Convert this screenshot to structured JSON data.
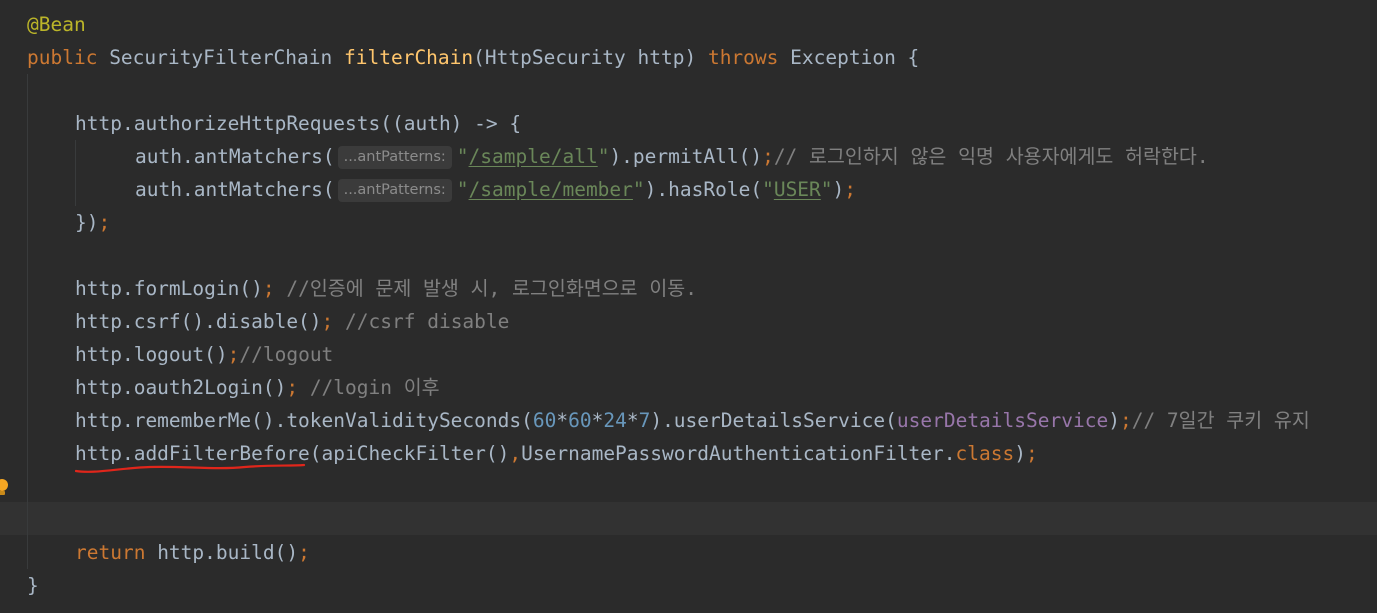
{
  "code": {
    "annotation": "@Bean",
    "sig": {
      "mod": "public",
      "ret_type": " SecurityFilterChain ",
      "method": "filterChain",
      "params": "(HttpSecurity http) ",
      "throws_kw": "throws",
      "rest": " Exception {"
    },
    "authorize_line": "http.authorizeHttpRequests((auth) -> {",
    "matcher1": {
      "pre": "auth.antMatchers(",
      "hint": "...antPatterns:",
      "q1": "\"",
      "path": "/sample/all",
      "q2": "\"",
      "mid": ").permitAll()",
      "semi": ";",
      "comment": "// 로그인하지 않은 익명 사용자에게도 허락한다."
    },
    "matcher2": {
      "pre": "auth.antMatchers(",
      "hint": "...antPatterns:",
      "q1": "\"",
      "path": "/sample/member",
      "q2": "\"",
      "mid": ").hasRole(",
      "q3": "\"",
      "role": "USER",
      "q4": "\"",
      "close": ")",
      "semi": ";"
    },
    "close_lambda": "})",
    "close_semi": ";",
    "formlogin": {
      "code": "http.formLogin()",
      "semi": ";",
      "comment": " //인증에 문제 발생 시, 로그인화면으로 이동."
    },
    "csrf": {
      "code": "http.csrf().disable()",
      "semi": ";",
      "comment": " //csrf disable"
    },
    "logout": {
      "code": "http.logout()",
      "semi": ";",
      "comment": "//logout"
    },
    "oauth": {
      "code": "http.oauth2Login()",
      "semi": ";",
      "comment": " //login 이후"
    },
    "remember": {
      "pre": "http.rememberMe().tokenValiditySeconds(",
      "n1": "60",
      "op1": "*",
      "n2": "60",
      "op2": "*",
      "n3": "24",
      "op3": "*",
      "n4": "7",
      "mid": ").userDetailsService(",
      "field": "userDetailsService",
      "close": ")",
      "semi": ";",
      "comment": "// 7일간 쿠키 유지"
    },
    "addfilter": {
      "pre": "http.addFilterBefore(apiCheckFilter()",
      "comma": ",",
      "cls": "UsernamePasswordAuthenticationFilter.",
      "class_kw": "class",
      "close": ")",
      "semi": ";"
    },
    "ret": {
      "kw": "return",
      "code": " http.build()",
      "semi": ";"
    },
    "close_brace": "}"
  },
  "colors": {
    "background": "#2b2b2b",
    "current_line": "#323232",
    "keyword": "#cc7832",
    "annotation": "#bbb529",
    "method_decl": "#ffc66d",
    "string": "#6a8759",
    "number": "#6897bb",
    "comment": "#808080",
    "field": "#9876aa",
    "default_text": "#a9b7c6",
    "error_underline": "#e0261b",
    "bulb": "#f5a623"
  },
  "icons": {
    "gutter": "lightbulb-icon",
    "marker": "squiggle-underline"
  }
}
